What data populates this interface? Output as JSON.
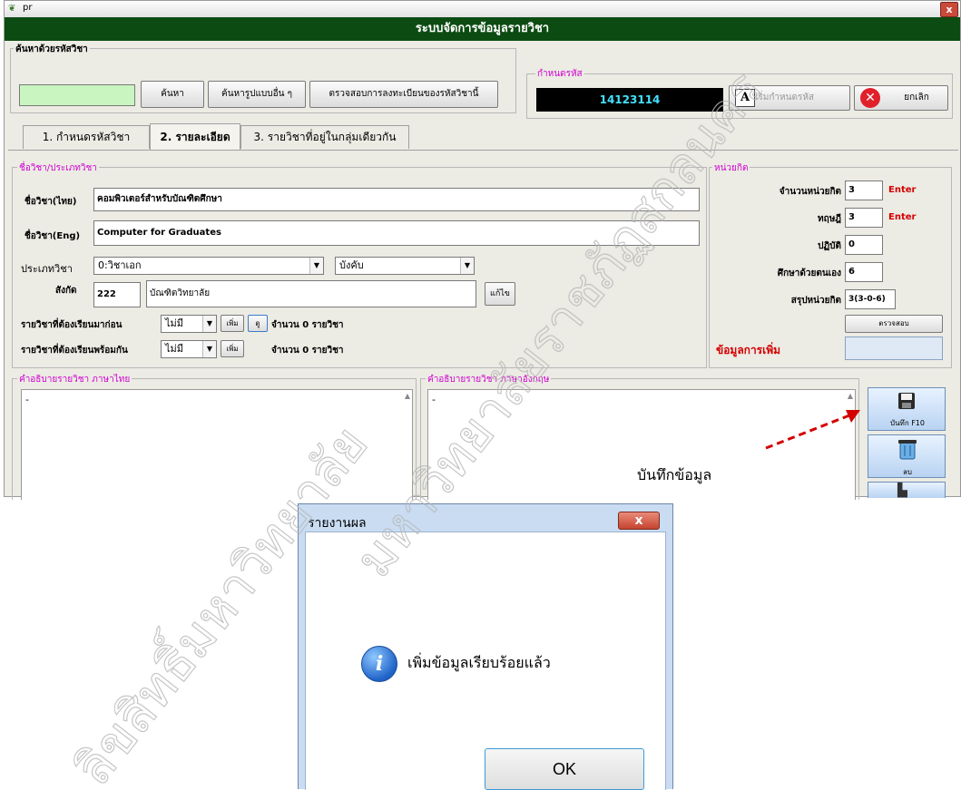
{
  "window": {
    "title": "pr",
    "close_label": "x",
    "header": "ระบบจัดการข้อมูลรายวิชา"
  },
  "search": {
    "legend": "ค้นหาด้วยรหัสวิชา",
    "value": "",
    "search_button": "ค้นหา",
    "other_search_button": "ค้นหารูปแบบอื่น ๆ",
    "check_registration_button": "ตรวจสอบการลงทะเบียนของรหัสวิชานี้"
  },
  "code": {
    "legend": "กำหนดรหัส",
    "value": "14123114",
    "new_code_button": "เริ่มกำหนดรหัส",
    "cancel_button": "ยกเลิก"
  },
  "tabs": [
    {
      "label": "1. กำหนดรหัสวิชา"
    },
    {
      "label": "2. รายละเอียด"
    },
    {
      "label": "3. รายวิชาที่อยู่ในกลุ่มเดียวกัน"
    }
  ],
  "details": {
    "legend": "ชื่อวิชา/ประเภทวิชา",
    "name_th_label": "ชื่อวิชา(ไทย)",
    "name_th": "คอมพิวเตอร์สำหรับบัณฑิตศึกษา",
    "name_en_label": "ชื่อวิชา(Eng)",
    "name_en": "Computer for Graduates",
    "type_label": "ประเภทวิชา",
    "type_value": "0:วิชาเอก",
    "compulsory_value": "บังคับ",
    "affiliation_label": "สังกัด",
    "affiliation_code": "222",
    "affiliation_name": "บัณฑิตวิทยาลัย",
    "edit_button": "แก้ไข",
    "prereq_label": "รายวิชาที่ต้องเรียนมาก่อน",
    "prereq_value": "ไม่มี",
    "add_button": "เพิ่ม",
    "view_button": "ดู",
    "prereq_count": "จำนวน 0 รายวิชา",
    "coreq_label": "รายวิชาที่ต้องเรียนพร้อมกัน",
    "coreq_value": "ไม่มี",
    "coreq_add_button": "เพิ่ม",
    "coreq_count": "จำนวน 0 รายวิชา"
  },
  "credits": {
    "legend": "หน่วยกิต",
    "total_label": "จำนวนหน่วยกิต",
    "total": "3",
    "theory_label": "ทฤษฎี",
    "theory": "3",
    "practice_label": "ปฏิบัติ",
    "practice": "0",
    "self_label": "ศึกษาด้วยตนเอง",
    "self": "6",
    "summary_label": "สรุปหน่วยกิต",
    "summary": "3(3-0-6)",
    "enter_hint_1": "Enter",
    "enter_hint_2": "Enter",
    "check_button": "ตรวจสอบ",
    "extra_label": "ข้อมูลการเพิ่ม"
  },
  "descriptions": {
    "thai_legend": "คำอธิบายรายวิชา ภาษาไทย",
    "thai_text": "-",
    "eng_legend": "คำอธิบายรายวิชา ภาษาอังกฤษ",
    "eng_text": "-"
  },
  "side_buttons": {
    "save_label": "บันทึก F10",
    "delete_label": "ลบ"
  },
  "annotation": {
    "text": "บันทึกข้อมูล",
    "color": "#d40000"
  },
  "dialog": {
    "title": "รายงานผล",
    "close_label": "x",
    "message": "เพิ่มข้อมูลเรียบร้อยแล้ว",
    "ok_label": "OK"
  },
  "watermark": {
    "text": "มหาวิทยาลัยราชภัฏสกลนคร"
  },
  "watermark_lower": {
    "text": "ลิขสิทธิ์มหาวิทยาลัย"
  }
}
